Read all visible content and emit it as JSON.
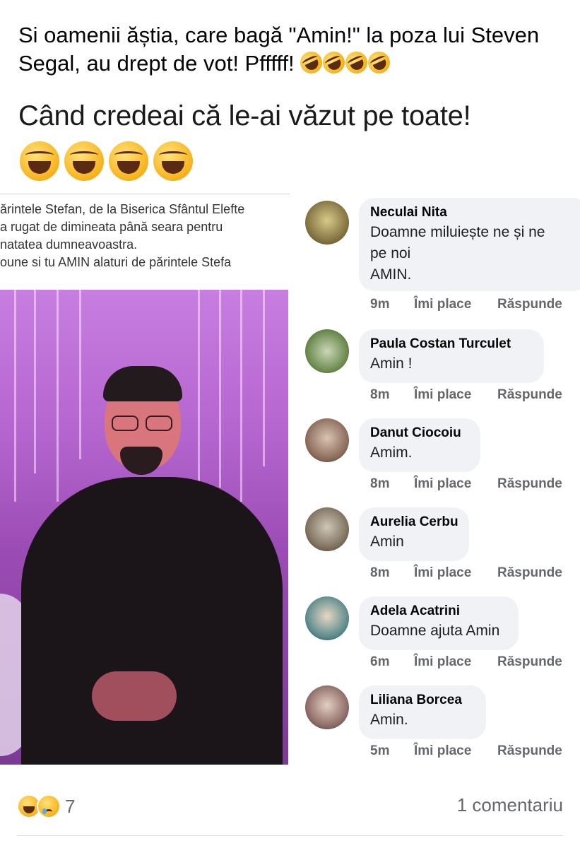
{
  "post": {
    "caption": "Si oamenii ăștia, care bagă \"Amin!\" la poza lui Steven Segal, au drept de vot! Pfffff!",
    "caption_emojis": [
      "rolling-on-floor-laughing",
      "rolling-on-floor-laughing",
      "rolling-on-floor-laughing",
      "rolling-on-floor-laughing"
    ],
    "headline": "Când credeai că le-ai văzut pe toate!",
    "headline_emojis": [
      "face-with-tears-of-joy",
      "face-with-tears-of-joy",
      "face-with-tears-of-joy",
      "face-with-tears-of-joy"
    ]
  },
  "embedded_post": {
    "lines": [
      "ărintele Stefan, de la Biserica Sfântul Elefte",
      "a rugat de dimineata până seara pentru",
      "natatea dumneavoastra.",
      "oune si tu AMIN  alaturi de  părintele Stefa"
    ]
  },
  "comments": [
    {
      "name": "Neculai Nita",
      "text": "Doamne miluiește ne și ne\npe noi\nAMIN.",
      "time": "9m",
      "like": "Îmi place",
      "reply": "Răspunde"
    },
    {
      "name": "Paula Costan Turculet",
      "text": "Amin !",
      "time": "8m",
      "like": "Îmi place",
      "reply": "Răspunde"
    },
    {
      "name": "Danut Ciocoiu",
      "text": "Amim.",
      "time": "8m",
      "like": "Îmi place",
      "reply": "Răspunde"
    },
    {
      "name": "Aurelia Cerbu",
      "text": "Amin",
      "time": "8m",
      "like": "Îmi place",
      "reply": "Răspunde"
    },
    {
      "name": "Adela Acatrini",
      "text": "Doamne ajuta Amin",
      "time": "6m",
      "like": "Îmi place",
      "reply": "Răspunde"
    },
    {
      "name": "Liliana Borcea",
      "text": "Amin.",
      "time": "5m",
      "like": "Îmi place",
      "reply": "Răspunde"
    }
  ],
  "footer": {
    "reaction_icons": [
      "haha-icon",
      "sad-icon"
    ],
    "reaction_count": "7",
    "comment_count": "1 comentariu"
  }
}
